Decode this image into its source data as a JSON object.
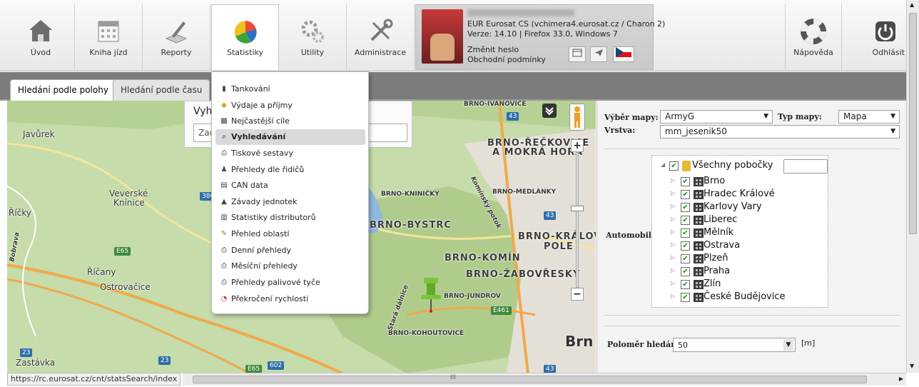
{
  "nav": {
    "uvod": "Úvod",
    "kniha_jizd": "Kniha jízd",
    "reporty": "Reporty",
    "statistiky": "Statistiky",
    "utility": "Utility",
    "administrace": "Administrace",
    "napoveda": "Nápověda",
    "odhlasit": "Odhlásit"
  },
  "user": {
    "server": "EUR Eurosat CS (vchimera4.eurosat.cz / Charon 2)",
    "version": "Verze: 14.10  |  Firefox 33.0, Windows 7",
    "change_password": "Změnit heslo",
    "terms": "Obchodní podmínky"
  },
  "tabs": {
    "by_location": "Hledání podle polohy",
    "by_time": "Hledání podle času"
  },
  "search": {
    "title_partial": "Vyh",
    "input_partial": "Zad"
  },
  "menu": {
    "items": [
      {
        "label": "Tankování",
        "icon": "fuel-icon"
      },
      {
        "label": "Výdaje a příjmy",
        "icon": "money-icon"
      },
      {
        "label": "Nejčastější cíle",
        "icon": "target-icon"
      },
      {
        "label": "Vyhledávání",
        "icon": "search-icon",
        "selected": true
      },
      {
        "label": "Tiskové sestavy",
        "icon": "print-icon"
      },
      {
        "label": "Přehledy dle řidičů",
        "icon": "driver-icon"
      },
      {
        "label": "CAN data",
        "icon": "can-icon"
      },
      {
        "label": "Závady jednotek",
        "icon": "car-fault-icon"
      },
      {
        "label": "Statistiky distributorů",
        "icon": "chart-icon"
      },
      {
        "label": "Přehled oblastí",
        "icon": "area-icon"
      },
      {
        "label": "Denní přehledy",
        "icon": "print-icon"
      },
      {
        "label": "Měsíční přehledy",
        "icon": "print-icon"
      },
      {
        "label": "Přehledy palivové tyče",
        "icon": "print-icon"
      },
      {
        "label": "Překročení rychlosti",
        "icon": "speed-icon"
      }
    ]
  },
  "map": {
    "labels": {
      "javurek": "Javůrek",
      "veverske": "Veverské",
      "knince": "Knínice",
      "ricky": "Říčky",
      "ricany": "Říčany",
      "ostrovacice": "Ostrovačice",
      "zastavka": "Zastávka",
      "bobrava": "Bobrava",
      "rec1": "BRNO-ŘEČKOVICE",
      "rec2": "A MOKRÁ HORA",
      "kninicky": "BRNO-KNINIČKY",
      "medlanky": "BRNO-MEDLÁNKY",
      "bystrc": "BRNO-BYSTRC",
      "kral1": "BRNO-KRÁLOVO",
      "kral2": "POLE",
      "komin": "BRNO-KOMÍN",
      "zab": "BRNO-ŽABOVŘESKY",
      "jundrov": "BRNO-JUNDROV",
      "kohout": "BRNO-KOHOUTOVICE",
      "ivanovice": "BRNO-IVANOVICE",
      "brno": "Brn",
      "potok": "Komínský potok",
      "stara": "Stará dálnice"
    },
    "roads": [
      "43",
      "43",
      "E65",
      "E461",
      "E65",
      "602",
      "23",
      "23",
      "43",
      "386"
    ]
  },
  "right": {
    "map_select_label": "Výběr mapy:",
    "map_select_value": "ArmyG",
    "map_type_label": "Typ mapy:",
    "map_type_value": "Mapa",
    "layer_label": "Vrstva:",
    "layer_value": "mm_jesenik50",
    "vehicle_label": "Automobil",
    "tree_root": "Všechny pobočky",
    "branches": [
      "Brno",
      "Hradec Králové",
      "Karlovy Vary",
      "Liberec",
      "Mělník",
      "Ostrava",
      "Plzeň",
      "Praha",
      "Zlín",
      "České Budějovice"
    ],
    "radius_label": "Poloměr hledání",
    "radius_value": "50",
    "radius_unit": "[m]"
  },
  "status": {
    "url": "https://rc.eurosat.cz/cnt/statsSearch/index",
    "scroll_mark": "III"
  }
}
